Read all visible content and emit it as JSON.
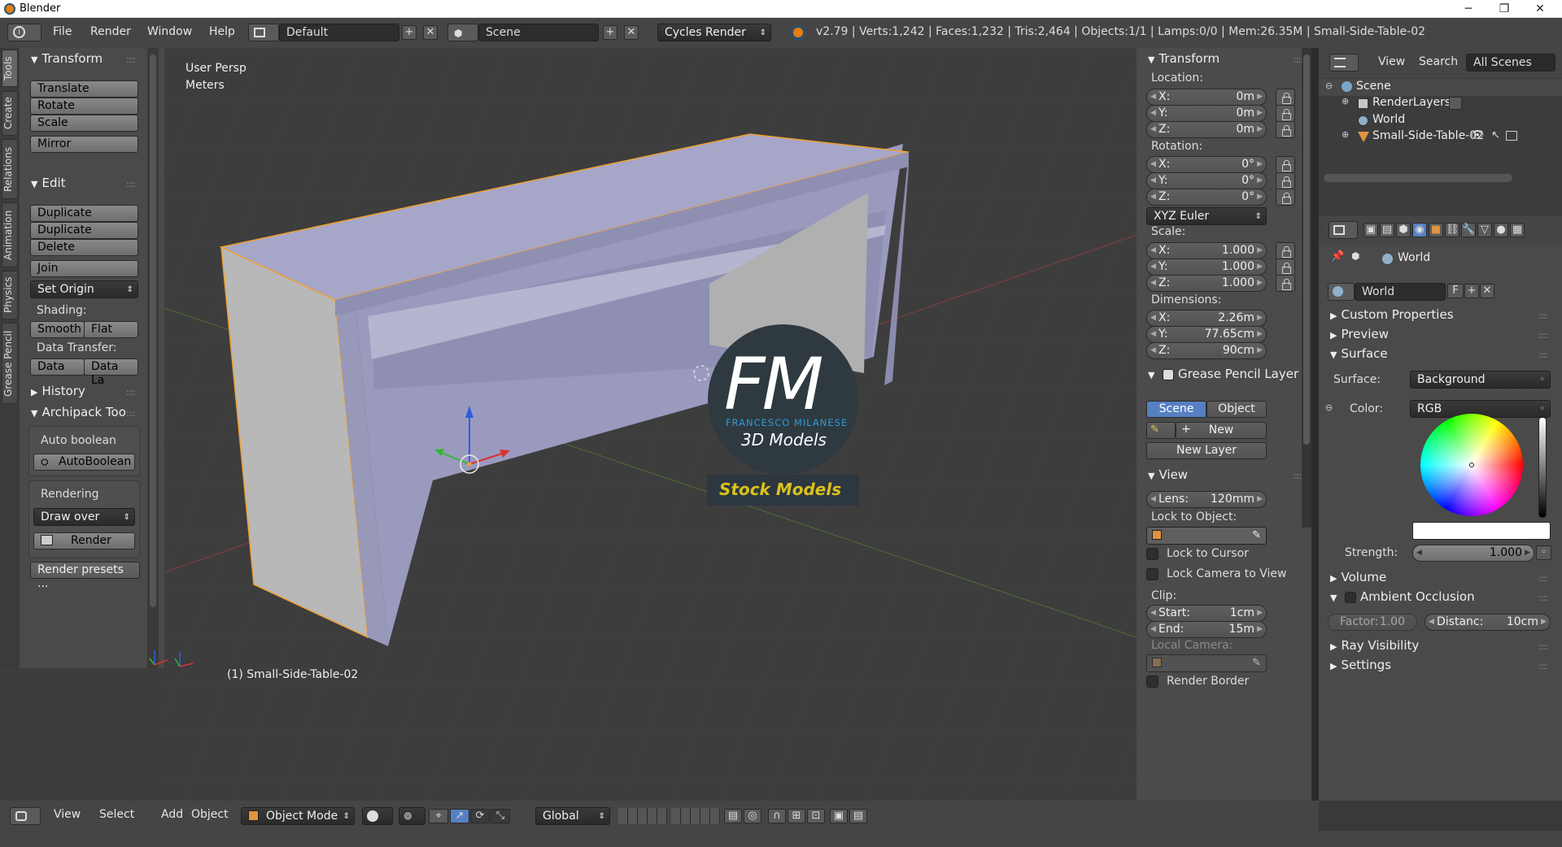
{
  "titlebar": {
    "title": "Blender",
    "minimize": "─",
    "maximize": "❐",
    "close": "✕"
  },
  "infobar": {
    "menus": [
      "File",
      "Render",
      "Window",
      "Help"
    ],
    "screen_layout": "Default",
    "scene": "Scene",
    "engine": "Cycles Render",
    "stats": "v2.79 | Verts:1,242 | Faces:1,232 | Tris:2,464 | Objects:1/1 | Lamps:0/0 | Mem:26.35M | Small-Side-Table-02"
  },
  "tool_tabs": [
    "Tools",
    "Create",
    "Relations",
    "Animation",
    "Physics",
    "Grease Pencil"
  ],
  "tools": {
    "transform_header": "Transform",
    "translate": "Translate",
    "rotate": "Rotate",
    "scale": "Scale",
    "mirror": "Mirror",
    "edit_header": "Edit",
    "duplicate": "Duplicate",
    "duplicate_linked": "Duplicate Linked",
    "delete": "Delete",
    "join": "Join",
    "set_origin": "Set Origin",
    "shading_label": "Shading:",
    "smooth": "Smooth",
    "flat": "Flat",
    "data_transfer_label": "Data Transfer:",
    "data": "Data",
    "data_layout": "Data La",
    "history_header": "History",
    "archipack_header": "Archipack Too",
    "auto_boolean_label": "Auto boolean",
    "auto_boolean_btn": "AutoBoolean",
    "rendering_label": "Rendering",
    "draw_over": "Draw over",
    "render": "Render",
    "render_presets": "Render presets ..."
  },
  "viewport": {
    "view_name": "User Persp",
    "units": "Meters",
    "object_label": "(1) Small-Side-Table-02",
    "watermark_initials": "FM",
    "watermark_name": "FRANCESCO MILANESE",
    "watermark_sub": "3D Models",
    "watermark_banner": "Stock Models"
  },
  "npanel": {
    "transform_header": "Transform",
    "location_label": "Location:",
    "location": [
      {
        "k": "X:",
        "v": "0m"
      },
      {
        "k": "Y:",
        "v": "0m"
      },
      {
        "k": "Z:",
        "v": "0m"
      }
    ],
    "rotation_label": "Rotation:",
    "rotation": [
      {
        "k": "X:",
        "v": "0°"
      },
      {
        "k": "Y:",
        "v": "0°"
      },
      {
        "k": "Z:",
        "v": "0°"
      }
    ],
    "rotation_mode": "XYZ Euler",
    "scale_label": "Scale:",
    "scale": [
      {
        "k": "X:",
        "v": "1.000"
      },
      {
        "k": "Y:",
        "v": "1.000"
      },
      {
        "k": "Z:",
        "v": "1.000"
      }
    ],
    "dimensions_label": "Dimensions:",
    "dimensions": [
      {
        "k": "X:",
        "v": "2.26m"
      },
      {
        "k": "Y:",
        "v": "77.65cm"
      },
      {
        "k": "Z:",
        "v": "90cm"
      }
    ],
    "grease_header": "Grease Pencil Layer",
    "scene_tab": "Scene",
    "object_tab": "Object",
    "new": "New",
    "new_layer": "New Layer",
    "view_header": "View",
    "lens_k": "Lens:",
    "lens_v": "120mm",
    "lock_to_object": "Lock to Object:",
    "lock_to_cursor": "Lock to Cursor",
    "lock_camera": "Lock Camera to View",
    "clip_label": "Clip:",
    "clip_start_k": "Start:",
    "clip_start_v": "1cm",
    "clip_end_k": "End:",
    "clip_end_v": "15m",
    "local_camera": "Local Camera:",
    "render_border": "Render Border"
  },
  "outliner": {
    "view": "View",
    "search": "Search",
    "all_scenes": "All Scenes",
    "items": [
      "Scene",
      "RenderLayers",
      "World",
      "Small-Side-Table-02"
    ]
  },
  "properties": {
    "breadcrumb": "World",
    "world_name": "World",
    "world_f": "F",
    "custom_props": "Custom Properties",
    "preview": "Preview",
    "surface_header": "Surface",
    "surface_label": "Surface:",
    "surface_value": "Background",
    "color_label": "Color:",
    "color_mode": "RGB",
    "strength_label": "Strength:",
    "strength_value": "1.000",
    "volume": "Volume",
    "ambient_occlusion": "Ambient Occlusion",
    "factor_k": "Factor:",
    "factor_v": "1.00",
    "distance_k": "Distanc:",
    "distance_v": "10cm",
    "ray_visibility": "Ray Visibility",
    "settings": "Settings"
  },
  "viewheader": {
    "menus": [
      "View",
      "Select",
      "Add",
      "Object"
    ],
    "mode": "Object Mode",
    "orientation": "Global"
  },
  "colors": {
    "selection_outline": "#f0a030",
    "table_face": "#a6a6c8",
    "watermark_blue": "#2e9bd6",
    "banner_text": "#d9c21b"
  }
}
